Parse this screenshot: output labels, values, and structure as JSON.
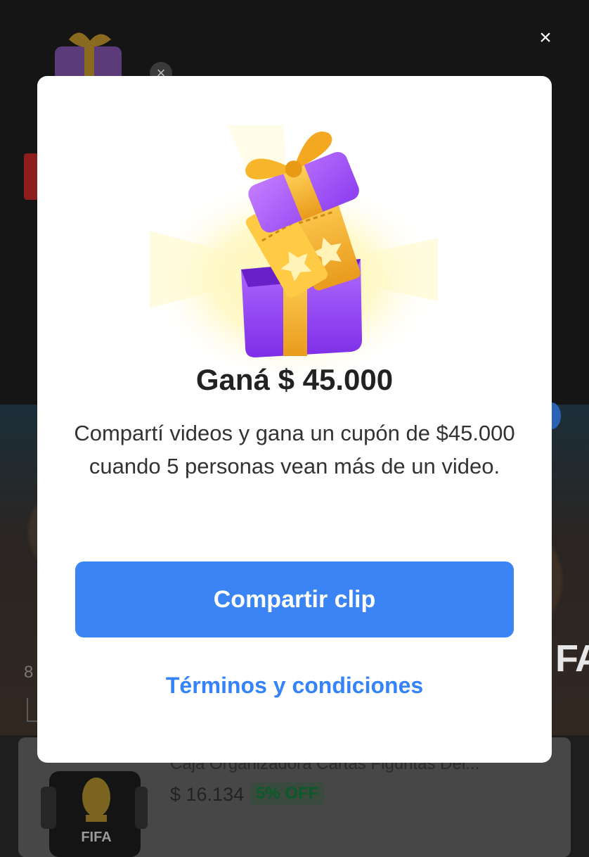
{
  "background": {
    "close_label": "×",
    "mini_close_label": "×",
    "corner_number": "8",
    "fa_text": "FA",
    "product": {
      "title": "Caja Organizadora Cartas Figuritas Del...",
      "price": "$ 16.134",
      "discount": "5% OFF",
      "logo_text": "FIFA"
    }
  },
  "modal": {
    "title": "Ganá $ 45.000",
    "description": "Compartí videos y gana un cupón de $45.000 cuando 5 personas vean más de un video.",
    "share_button": "Compartir clip",
    "terms_link": "Términos y condiciones"
  },
  "colors": {
    "accent": "#3a84f5",
    "link": "#3483fa",
    "gift_purple": "#9b4dff",
    "ribbon_gold": "#f5b82e",
    "discount_green": "#00a650"
  },
  "icons": {
    "close": "close-icon",
    "gift": "gift-box-icon"
  }
}
